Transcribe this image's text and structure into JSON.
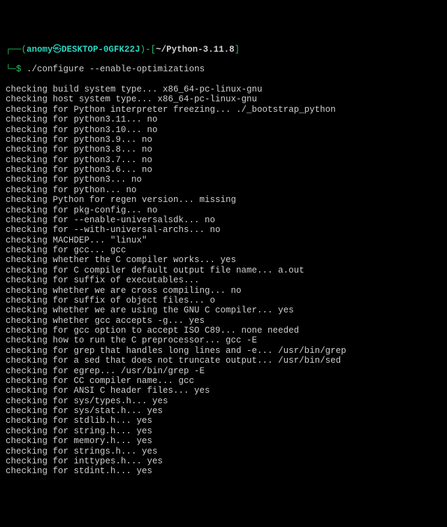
{
  "prompt": {
    "open_paren": "┌──(",
    "user": "anomy",
    "at": "㉿",
    "host": "DESKTOP-0GFK22J",
    "close_paren": ")",
    "dash": "-",
    "open_bracket": "[",
    "path": "~/Python-3.11.8",
    "close_bracket": "]",
    "second_line_prefix": "└─",
    "dollar": "$ ",
    "command": "./configure --enable-optimizations"
  },
  "output_lines": [
    "checking build system type... x86_64-pc-linux-gnu",
    "checking host system type... x86_64-pc-linux-gnu",
    "checking for Python interpreter freezing... ./_bootstrap_python",
    "checking for python3.11... no",
    "checking for python3.10... no",
    "checking for python3.9... no",
    "checking for python3.8... no",
    "checking for python3.7... no",
    "checking for python3.6... no",
    "checking for python3... no",
    "checking for python... no",
    "checking Python for regen version... missing",
    "checking for pkg-config... no",
    "checking for --enable-universalsdk... no",
    "checking for --with-universal-archs... no",
    "checking MACHDEP... \"linux\"",
    "checking for gcc... gcc",
    "checking whether the C compiler works... yes",
    "checking for C compiler default output file name... a.out",
    "checking for suffix of executables...",
    "checking whether we are cross compiling... no",
    "checking for suffix of object files... o",
    "checking whether we are using the GNU C compiler... yes",
    "checking whether gcc accepts -g... yes",
    "checking for gcc option to accept ISO C89... none needed",
    "checking how to run the C preprocessor... gcc -E",
    "checking for grep that handles long lines and -e... /usr/bin/grep",
    "checking for a sed that does not truncate output... /usr/bin/sed",
    "checking for egrep... /usr/bin/grep -E",
    "checking for CC compiler name... gcc",
    "checking for ANSI C header files... yes",
    "checking for sys/types.h... yes",
    "checking for sys/stat.h... yes",
    "checking for stdlib.h... yes",
    "checking for string.h... yes",
    "checking for memory.h... yes",
    "checking for strings.h... yes",
    "checking for inttypes.h... yes",
    "checking for stdint.h... yes"
  ]
}
